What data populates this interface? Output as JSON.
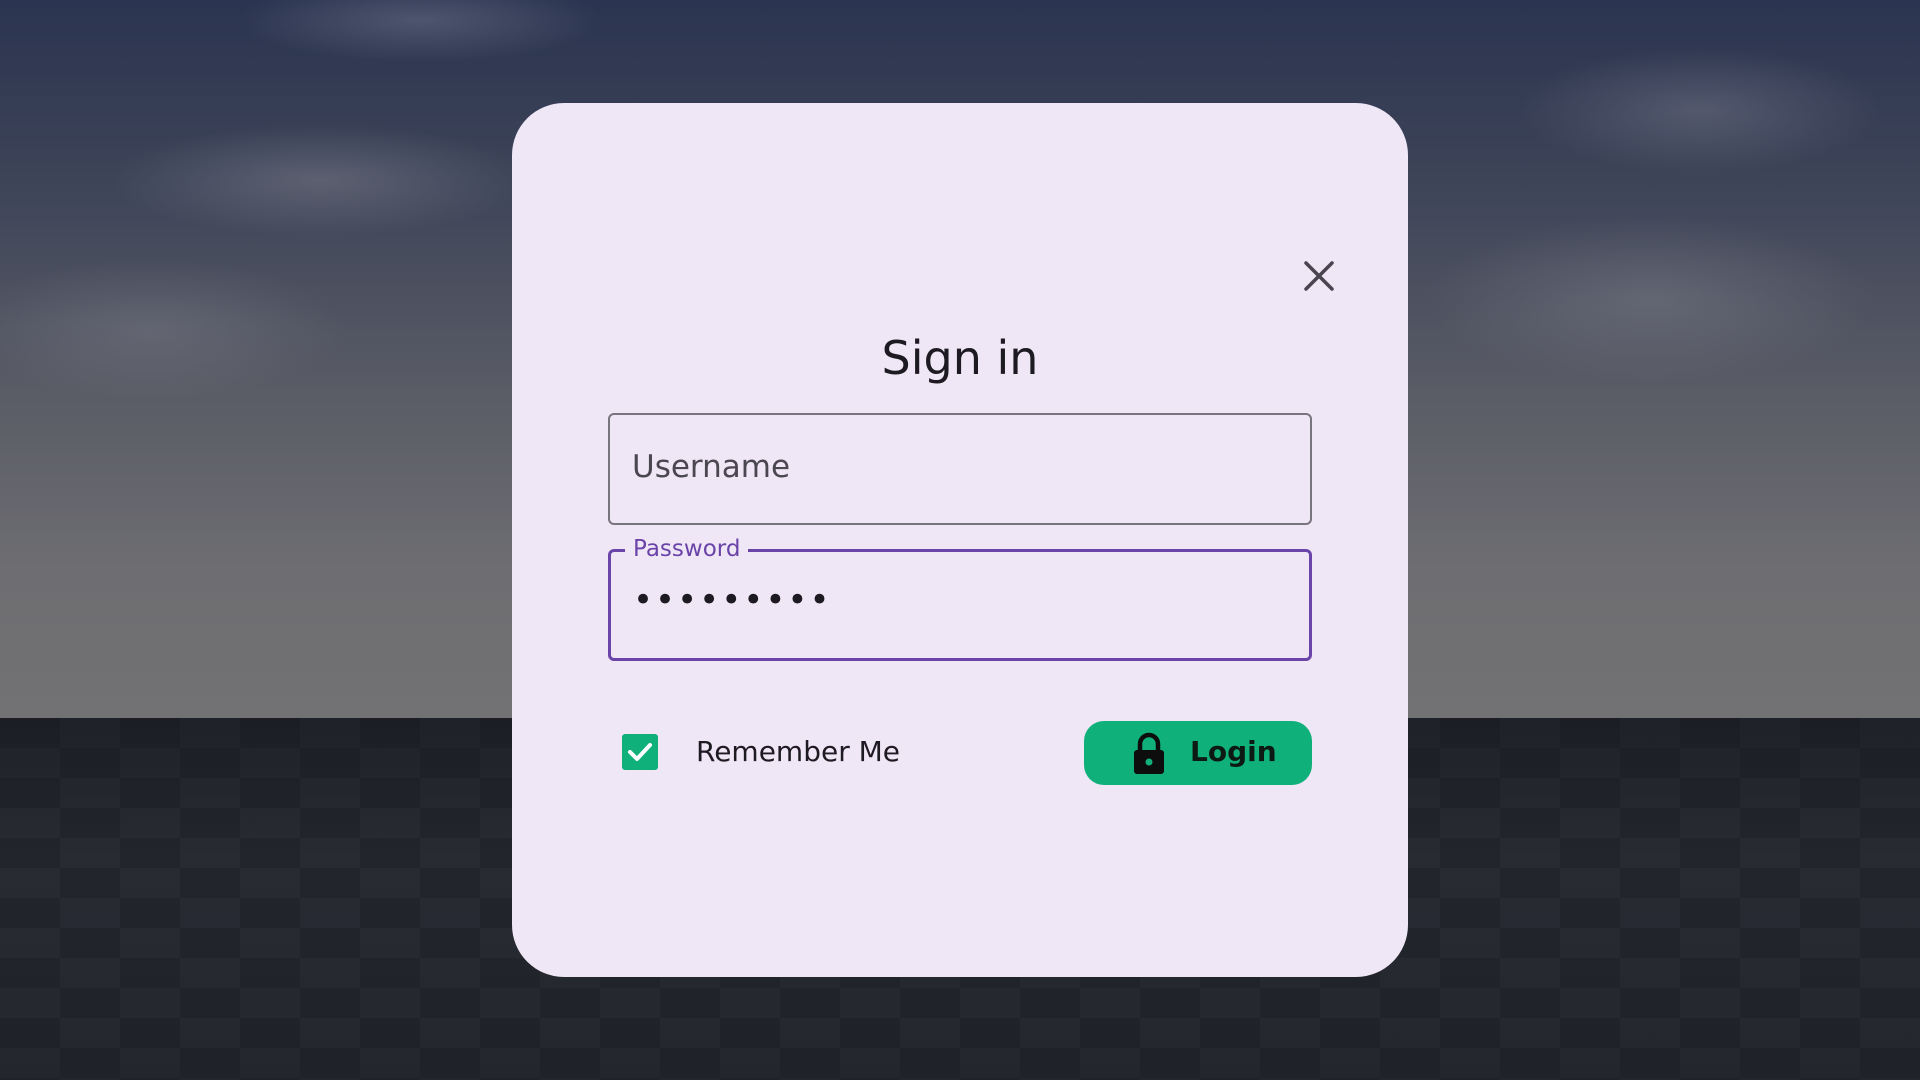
{
  "dialog": {
    "title": "Sign in",
    "close_icon": "close-icon"
  },
  "form": {
    "username": {
      "placeholder": "Username",
      "value": ""
    },
    "password": {
      "label": "Password",
      "value": "•••••••••"
    },
    "remember_me": {
      "label": "Remember Me",
      "checked": true
    },
    "login_button": {
      "label": "Login",
      "icon": "lock-icon"
    }
  },
  "colors": {
    "dialog_background": "#efe6f6",
    "accent_purple": "#6a44a8",
    "accent_green": "#0fb07a",
    "text": "#1d1b21"
  }
}
